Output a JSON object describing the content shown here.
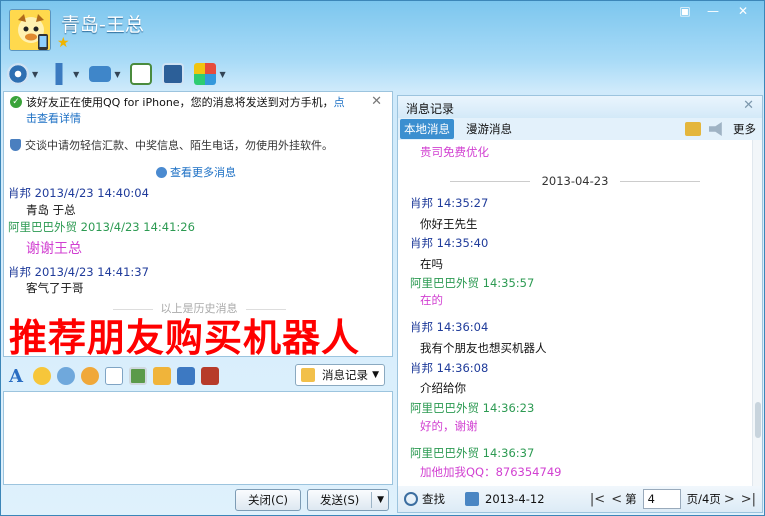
{
  "window": {
    "title": "青岛-王总",
    "controls": [
      "▣",
      "—",
      "✕"
    ]
  },
  "toolbar": {
    "icons": [
      "video-icon",
      "microphone-icon",
      "file-transfer-icon",
      "sms-icon",
      "screen-share-icon",
      "apps-icon"
    ]
  },
  "left_panel": {
    "notice_iphone_text": "该好友正在使用QQ for iPhone，您的消息将发送到对方手机，",
    "notice_iphone_link_1": "点",
    "notice_iphone_link_2": "击查看详情",
    "notice_security": "交谈中请勿轻信汇款、中奖信息、陌生电话，勿使用外挂软件。",
    "view_more": "查看更多消息",
    "messages": [
      {
        "sender": "肖邦",
        "time": "2013/4/23 14:40:04",
        "text": "青岛  于总"
      },
      {
        "sender": "阿里巴巴外贸",
        "time": "2013/4/23 14:41:26",
        "text": "谢谢王总"
      },
      {
        "sender": "肖邦",
        "time": "2013/4/23 14:41:37",
        "text": "客气了于哥"
      }
    ],
    "history_divider": "以上是历史消息",
    "overlay_text": "推荐朋友购买机器人"
  },
  "format_bar": {
    "record_button": "消息记录"
  },
  "buttons": {
    "close": "关闭(C)",
    "send": "发送(S)"
  },
  "right_panel": {
    "title": "消息记录",
    "tab_local": "本地消息",
    "tab_roaming": "漫游消息",
    "more": "更多",
    "top_cut_text": "贵司免费优化",
    "date": "2013-04-23",
    "messages": [
      {
        "sender": "肖邦",
        "time": "14:35:27",
        "text": "你好王先生"
      },
      {
        "sender": "肖邦",
        "time": "14:35:40",
        "text": "在吗"
      },
      {
        "sender": "阿里巴巴外贸",
        "time": "14:35:57",
        "text": "在的"
      },
      {
        "sender": "肖邦",
        "time": "14:36:04",
        "text": "我有个朋友也想买机器人"
      },
      {
        "sender": "肖邦",
        "time": "14:36:08",
        "text": "介绍给你"
      },
      {
        "sender": "阿里巴巴外贸",
        "time": "14:36:23",
        "text": "好的，谢谢"
      },
      {
        "sender": "阿里巴巴外贸",
        "time": "14:36:37",
        "text": "加他加我QQ：876354749"
      }
    ],
    "footer": {
      "search": "查找",
      "date": "2013-4-12",
      "page_prefix": "第",
      "page_value": "4",
      "page_suffix": "页/4页"
    }
  },
  "colors": {
    "sender_blue": "#1f3b9a",
    "sender_green": "#2c9a52",
    "pink_text": "#d13fd1",
    "overlay_red": "#ff0000"
  }
}
